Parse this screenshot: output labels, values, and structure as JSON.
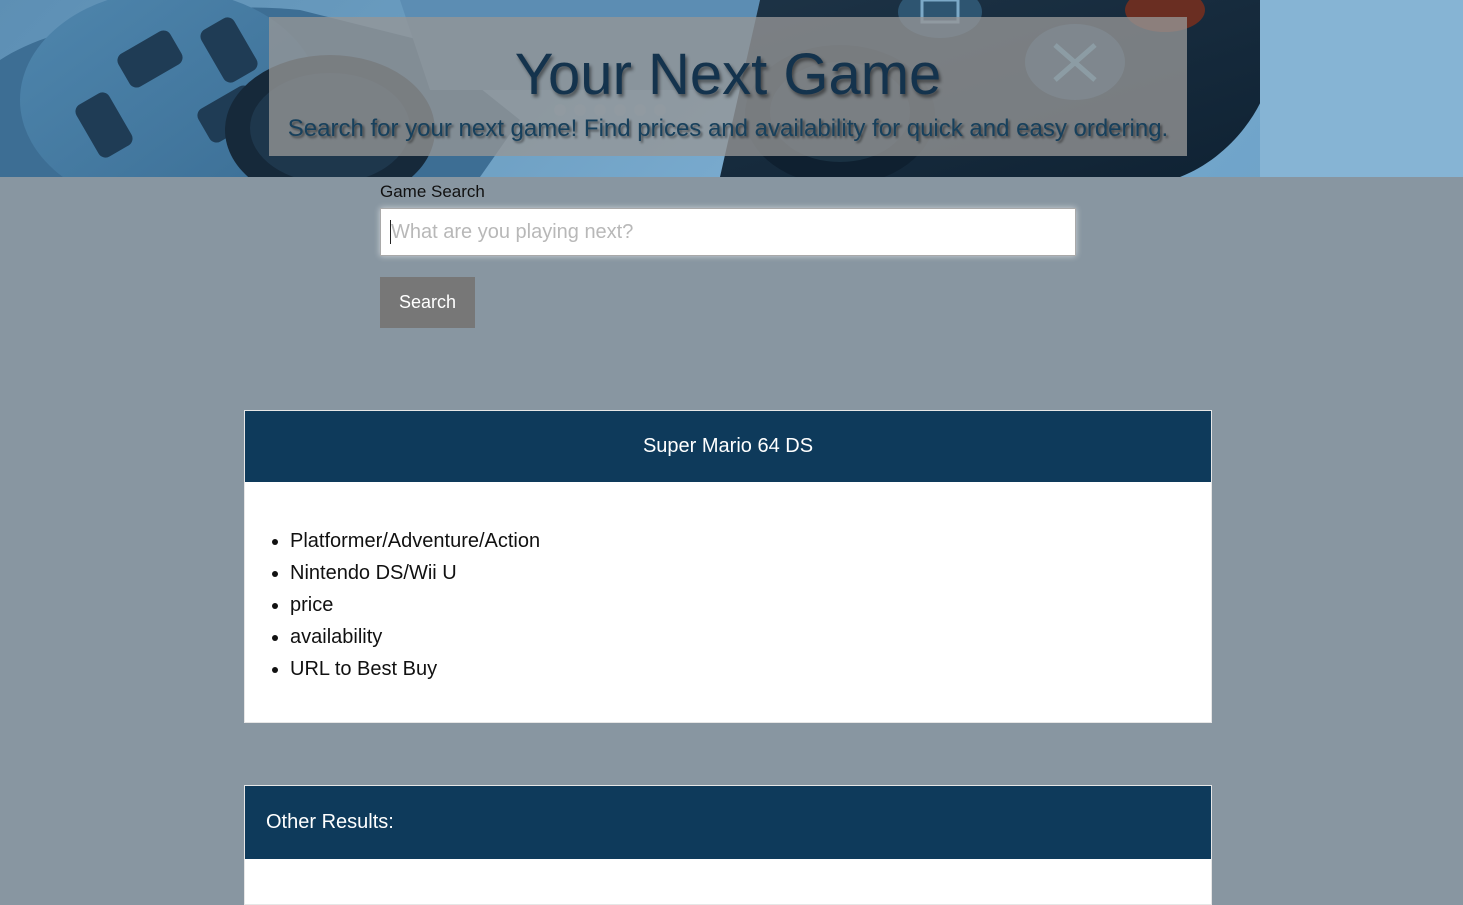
{
  "hero": {
    "title": "Your Next Game",
    "subtitle": "Search for your next game! Find prices and availability for quick and easy ordering."
  },
  "search": {
    "label": "Game Search",
    "placeholder": "What are you playing next?",
    "value": "",
    "button_label": "Search"
  },
  "result": {
    "title": "Super Mario 64 DS",
    "details": [
      "Platformer/Adventure/Action",
      "Nintendo DS/Wii U",
      "price",
      "availability",
      "URL to Best Buy"
    ]
  },
  "other_results": {
    "title": "Other Results:"
  },
  "colors": {
    "page_bg": "#8896a1",
    "card_header": "#0e3a5b",
    "button_bg": "#777777",
    "hero_title": "#14334d"
  }
}
